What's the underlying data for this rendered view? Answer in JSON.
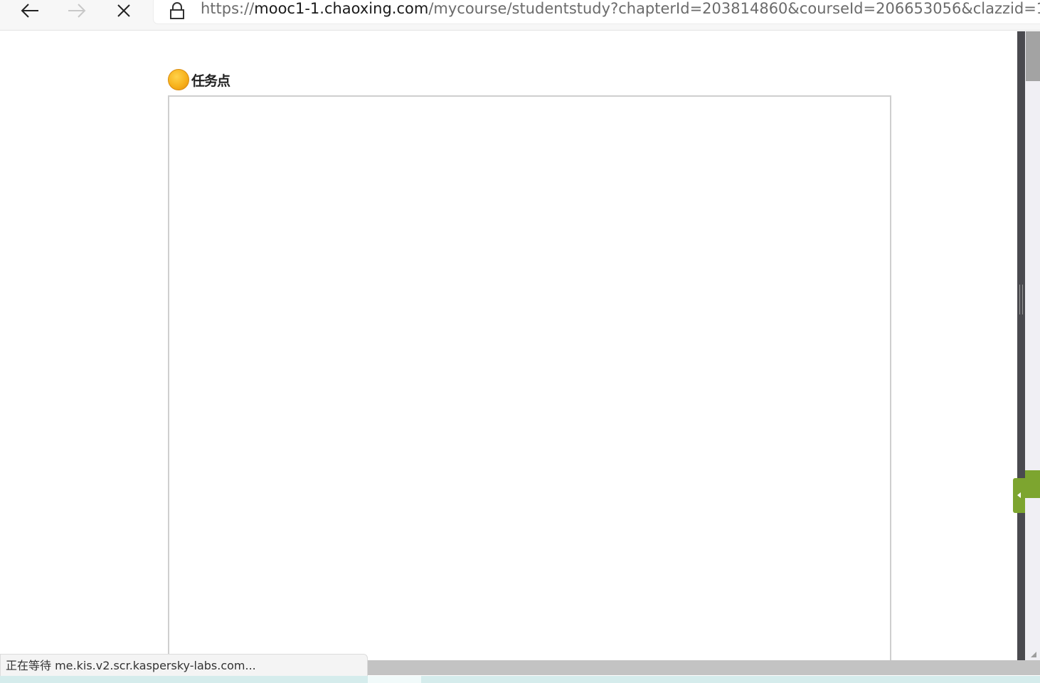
{
  "browser": {
    "url_scheme": "https://",
    "url_host": "mooc1-1.chaoxing.com",
    "url_path": "/mycourse/studentstudy?chapterId=203814860&courseId=206653056&clazzid=1",
    "icons": {
      "back": "back-arrow-icon",
      "forward": "forward-arrow-icon",
      "stop": "close-icon",
      "lock": "lock-icon"
    }
  },
  "content": {
    "task_title": "任务点",
    "task_icon": "orange-dot-icon",
    "task_dot_color": "#f7b21c"
  },
  "statusbar": {
    "text": "正在等待 me.kis.v2.scr.kaspersky-labs.com..."
  },
  "colors": {
    "side_tab_green": "#7da52f",
    "side_strip": "#4a4a4f",
    "frame_border": "#cfcfcf"
  }
}
